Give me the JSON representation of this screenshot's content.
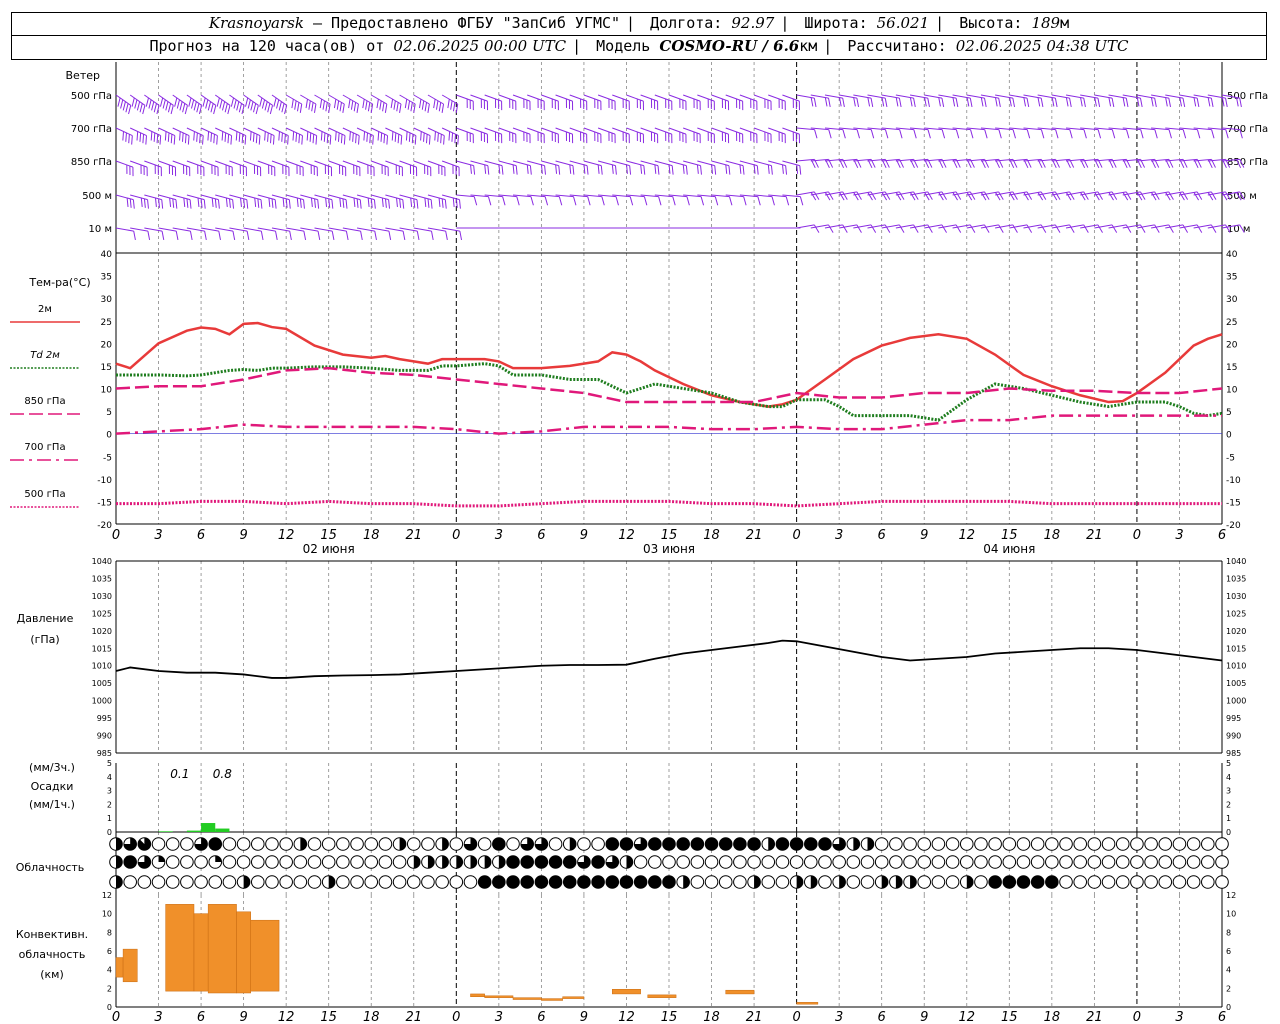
{
  "header": {
    "city": "Krasnoyarsk",
    "provider": "— Предоставлено ФГБУ \"ЗапСиб УГМС\"",
    "lon_label": "Долгота:",
    "lon_value": "92.97",
    "lat_label": "Широта:",
    "lat_value": "56.021",
    "alt_label": "Высота:",
    "alt_value": "189",
    "alt_unit": "м",
    "forecast_label": "Прогноз на 120 часа(ов) от",
    "forecast_from": "02.06.2025 00:00 UTC",
    "model_label": "Модель",
    "model_name": "COSMO-RU / 6.6",
    "model_unit": "км",
    "calc_label": "Рассчитано:",
    "calc_time": "02.06.2025 04:38 UTC"
  },
  "labels": {
    "wind_title": "Ветер",
    "wind_levels": [
      "500 гПа",
      "700 гПа",
      "850 гПа",
      "500 м",
      "10 м"
    ],
    "temp_title": "Тем-ра(°C)",
    "pressure_title": "Давление",
    "pressure_unit": "(гПа)",
    "precip_unit_3h": "(мм/3ч.)",
    "precip_title": "Осадки",
    "precip_unit_1h": "(мм/1ч.)",
    "cloud_title": "Облачность",
    "conv_title_1": "Конвективн.",
    "conv_title_2": "облачность",
    "conv_unit": "(км)"
  },
  "x_axis": {
    "hour_ticks": [
      "0",
      "3",
      "6",
      "9",
      "12",
      "15",
      "18",
      "21",
      "0",
      "3",
      "6",
      "9",
      "12",
      "15",
      "18",
      "21",
      "0",
      "3",
      "6",
      "9",
      "12",
      "15",
      "18",
      "21",
      "0",
      "3",
      "6"
    ],
    "day_labels": [
      "02 июня",
      "03 июня",
      "04 июня"
    ],
    "day_label_hours": [
      15,
      39,
      63
    ],
    "day_boundaries_h": [
      24,
      48,
      72
    ]
  },
  "colors": {
    "wind": "#8a2be2",
    "t2m": "#e83a3a",
    "td2m": "#1e7d1e",
    "t850": "#e0187a",
    "t700": "#e0187a",
    "t500": "#e0187a",
    "pressure": "#000000",
    "precip": "#22cc22",
    "convective": "#f0902a",
    "grid": "#888888"
  },
  "chart_data": [
    {
      "type": "line",
      "title": "Тем-ра(°C)",
      "ylim": [
        -20,
        40
      ],
      "yticks": [
        -20,
        -15,
        -10,
        -5,
        0,
        5,
        10,
        15,
        20,
        25,
        30,
        35,
        40
      ],
      "series": [
        {
          "name": "2м",
          "style": "solid",
          "x": [
            0,
            1,
            3,
            5,
            6,
            7,
            8,
            9,
            10,
            11,
            12,
            14,
            16,
            18,
            19,
            20,
            21,
            22,
            23,
            24,
            26,
            27,
            28,
            30,
            32,
            34,
            35,
            36,
            37,
            38,
            40,
            42,
            44,
            46,
            47,
            48,
            50,
            52,
            54,
            56,
            58,
            60,
            62,
            64,
            66,
            68,
            70,
            71,
            72,
            74,
            76,
            77,
            78
          ],
          "y": [
            15.5,
            14.5,
            20,
            22.8,
            23.5,
            23.2,
            22,
            24.3,
            24.5,
            23.6,
            23.2,
            19.5,
            17.5,
            16.8,
            17.2,
            16.5,
            16,
            15.5,
            16.5,
            16.5,
            16.5,
            16,
            14.5,
            14.5,
            15,
            16,
            18,
            17.5,
            16,
            14,
            11,
            8.5,
            7,
            6,
            6.5,
            7.5,
            12,
            16.5,
            19.5,
            21.2,
            22,
            21,
            17.5,
            13,
            10.5,
            8.5,
            7,
            7.2,
            9,
            13.5,
            19.5,
            21,
            22
          ]
        },
        {
          "name": "Td 2м",
          "style": "dotted",
          "x": [
            0,
            3,
            5,
            6,
            7,
            8,
            9,
            10,
            11,
            12,
            14,
            16,
            18,
            20,
            22,
            23,
            24,
            26,
            27,
            28,
            30,
            32,
            34,
            35,
            36,
            37,
            38,
            40,
            42,
            44,
            46,
            47,
            48,
            50,
            51,
            52,
            54,
            56,
            57,
            58,
            60,
            62,
            64,
            66,
            68,
            70,
            71,
            72,
            74,
            75,
            76,
            77,
            78
          ],
          "y": [
            13,
            13,
            12.8,
            13,
            13.5,
            14,
            14.2,
            14,
            14.5,
            14.5,
            14.8,
            14.8,
            14.5,
            14,
            14,
            15,
            15,
            15.5,
            15,
            13,
            13,
            12,
            12,
            10.5,
            9,
            10,
            11,
            10,
            9,
            7,
            6,
            6,
            7.5,
            7.5,
            6,
            4,
            4,
            4,
            3.5,
            3,
            7.5,
            11,
            10,
            8.5,
            7,
            6,
            6.5,
            7,
            7,
            6,
            4.5,
            4,
            4.5
          ]
        },
        {
          "name": "850 гПа",
          "style": "dashed",
          "x": [
            0,
            3,
            6,
            9,
            12,
            15,
            18,
            21,
            24,
            27,
            30,
            33,
            36,
            39,
            42,
            45,
            48,
            51,
            54,
            57,
            60,
            63,
            66,
            69,
            72,
            75,
            78
          ],
          "y": [
            10,
            10.5,
            10.5,
            12,
            14,
            14.5,
            13.5,
            13,
            12,
            11,
            10,
            9,
            7,
            7,
            7,
            7,
            9,
            8,
            8,
            9,
            9,
            10,
            9.5,
            9.5,
            9,
            9,
            10
          ]
        },
        {
          "name": "700 гПа",
          "style": "dashdot",
          "x": [
            0,
            3,
            6,
            9,
            12,
            15,
            18,
            21,
            24,
            27,
            30,
            33,
            36,
            39,
            42,
            45,
            48,
            51,
            54,
            57,
            60,
            63,
            66,
            69,
            72,
            75,
            78
          ],
          "y": [
            0,
            0.5,
            1,
            2,
            1.5,
            1.5,
            1.5,
            1.5,
            1,
            0,
            0.5,
            1.5,
            1.5,
            1.5,
            1,
            1,
            1.5,
            1,
            1,
            2,
            3,
            3,
            4,
            4,
            4,
            4,
            4
          ]
        },
        {
          "name": "500 гПа",
          "style": "dotted",
          "x": [
            0,
            3,
            6,
            9,
            12,
            15,
            18,
            21,
            24,
            27,
            30,
            33,
            36,
            39,
            42,
            45,
            48,
            51,
            54,
            57,
            60,
            63,
            66,
            69,
            72,
            75,
            78
          ],
          "y": [
            -15.5,
            -15.5,
            -15,
            -15,
            -15.5,
            -15,
            -15.5,
            -15.5,
            -16,
            -16,
            -15.5,
            -15,
            -15,
            -15,
            -15.5,
            -15.5,
            -16,
            -15.5,
            -15,
            -15,
            -15,
            -15,
            -15.5,
            -15.5,
            -15.5,
            -15.5,
            -15.5
          ]
        }
      ]
    },
    {
      "type": "line",
      "title": "Давление",
      "ylabel": "(гПа)",
      "ylim": [
        985,
        1040
      ],
      "yticks": [
        985,
        990,
        995,
        1000,
        1005,
        1010,
        1015,
        1020,
        1025,
        1030,
        1035,
        1040
      ],
      "series": [
        {
          "x": [
            0,
            1,
            3,
            5,
            7,
            9,
            11,
            12,
            14,
            16,
            18,
            20,
            22,
            24,
            26,
            28,
            30,
            32,
            34,
            36,
            38,
            40,
            42,
            44,
            46,
            47,
            48,
            50,
            52,
            54,
            56,
            58,
            60,
            62,
            64,
            66,
            68,
            70,
            72,
            74,
            76,
            78
          ],
          "y": [
            1008.5,
            1009.5,
            1008.5,
            1008,
            1008,
            1007.5,
            1006.5,
            1006.5,
            1007,
            1007.2,
            1007.3,
            1007.5,
            1008,
            1008.5,
            1009,
            1009.5,
            1010,
            1010.2,
            1010.2,
            1010.3,
            1012,
            1013.5,
            1014.5,
            1015.5,
            1016.5,
            1017.2,
            1017,
            1015.5,
            1014,
            1012.5,
            1011.5,
            1012,
            1012.5,
            1013.5,
            1014,
            1014.5,
            1015,
            1015,
            1014.5,
            1013.5,
            1012.5,
            1011.5
          ]
        }
      ]
    },
    {
      "type": "bar",
      "title": "Осадки",
      "ylim": [
        0,
        5
      ],
      "yticks": [
        0,
        1,
        2,
        3,
        4,
        5
      ],
      "labels_3h": [
        {
          "x_h": 4.5,
          "text": "0.1"
        },
        {
          "x_h": 7.5,
          "text": "0.8"
        }
      ],
      "bars": [
        {
          "x0": 3,
          "x1": 4,
          "value": 0.05
        },
        {
          "x0": 5,
          "x1": 6,
          "value": 0.1
        },
        {
          "x0": 6,
          "x1": 7,
          "value": 0.65
        },
        {
          "x0": 7,
          "x1": 8,
          "value": 0.25
        }
      ]
    },
    {
      "type": "table",
      "title": "Облачность",
      "note": "cloud cover symbols per hour, 3 rows, value = oktas 0-8",
      "rows": [
        [
          4,
          6,
          7,
          0,
          0,
          0,
          6,
          8,
          0,
          0,
          0,
          0,
          0,
          4,
          0,
          0,
          0,
          0,
          0,
          0,
          4,
          0,
          0,
          4,
          0,
          6,
          0,
          8,
          0,
          6,
          6,
          0,
          4,
          0,
          0,
          8,
          8,
          6,
          8,
          8,
          8,
          8,
          8,
          8,
          8,
          8,
          4,
          8,
          8,
          8,
          8,
          6,
          4,
          4,
          0,
          0,
          0,
          0,
          0,
          0,
          0,
          0,
          0,
          0,
          0,
          0,
          0,
          0,
          0,
          0,
          0,
          0,
          0,
          0,
          0,
          0,
          0,
          0,
          0
        ],
        [
          4,
          8,
          6,
          2,
          0,
          0,
          0,
          2,
          0,
          0,
          0,
          0,
          0,
          0,
          0,
          0,
          0,
          0,
          0,
          0,
          0,
          4,
          4,
          4,
          4,
          4,
          4,
          4,
          8,
          8,
          8,
          8,
          8,
          6,
          8,
          6,
          4,
          0,
          0,
          0,
          0,
          0,
          0,
          0,
          0,
          0,
          0,
          0,
          0,
          0,
          0,
          0,
          0,
          0,
          0,
          0,
          0,
          0,
          0,
          0,
          0,
          0,
          0,
          0,
          0,
          0,
          0,
          0,
          0,
          0,
          0,
          0,
          0,
          0,
          0,
          0,
          0,
          0,
          0
        ],
        [
          4,
          0,
          0,
          0,
          0,
          0,
          0,
          0,
          0,
          4,
          0,
          0,
          0,
          0,
          0,
          4,
          0,
          0,
          0,
          0,
          0,
          0,
          0,
          0,
          0,
          0,
          8,
          8,
          8,
          8,
          8,
          8,
          8,
          8,
          8,
          8,
          8,
          8,
          8,
          8,
          4,
          0,
          0,
          0,
          0,
          4,
          0,
          0,
          4,
          4,
          0,
          4,
          0,
          0,
          4,
          4,
          4,
          0,
          0,
          0,
          4,
          0,
          8,
          8,
          8,
          8,
          8,
          0,
          0,
          0,
          0,
          0,
          0,
          0,
          0,
          0,
          0,
          0,
          0
        ]
      ]
    },
    {
      "type": "bar",
      "title": "Конвективн. облачность",
      "ylabel": "(км)",
      "ylim": [
        0,
        12
      ],
      "yticks": [
        0,
        2,
        4,
        6,
        8,
        10,
        12
      ],
      "bars": [
        {
          "x0": 0,
          "x1": 0.5,
          "bottom": 3.2,
          "top": 5.3
        },
        {
          "x0": 0.5,
          "x1": 1.5,
          "bottom": 2.7,
          "top": 6.2
        },
        {
          "x0": 3.5,
          "x1": 5.5,
          "bottom": 1.7,
          "top": 11.0
        },
        {
          "x0": 5.5,
          "x1": 6.5,
          "bottom": 1.7,
          "top": 10.0
        },
        {
          "x0": 6.5,
          "x1": 8.5,
          "bottom": 1.5,
          "top": 11.0
        },
        {
          "x0": 8.5,
          "x1": 9.5,
          "bottom": 1.5,
          "top": 10.2
        },
        {
          "x0": 9.5,
          "x1": 11.5,
          "bottom": 1.7,
          "top": 9.3
        },
        {
          "x0": 25,
          "x1": 26,
          "bottom": 1.1,
          "top": 1.4
        },
        {
          "x0": 26,
          "x1": 28,
          "bottom": 1.0,
          "top": 1.2
        },
        {
          "x0": 28,
          "x1": 30,
          "bottom": 0.8,
          "top": 1.0
        },
        {
          "x0": 30,
          "x1": 31.5,
          "bottom": 0.7,
          "top": 0.9
        },
        {
          "x0": 31.5,
          "x1": 33,
          "bottom": 0.9,
          "top": 1.1
        },
        {
          "x0": 35,
          "x1": 37,
          "bottom": 1.4,
          "top": 1.9
        },
        {
          "x0": 37.5,
          "x1": 39.5,
          "bottom": 1.0,
          "top": 1.3
        },
        {
          "x0": 43,
          "x1": 45,
          "bottom": 1.4,
          "top": 1.8
        },
        {
          "x0": 48,
          "x1": 49.5,
          "bottom": 0.3,
          "top": 0.5
        }
      ]
    }
  ],
  "wind": {
    "levels": [
      "500 гПа",
      "700 гПа",
      "850 гПа",
      "500 м",
      "10 м"
    ],
    "hours_step": 1,
    "note": "barbs: direction in degrees and speed in m/s per level segment",
    "segments": [
      {
        "level": 0,
        "from_h": 0,
        "to_h": 12,
        "dir": 235,
        "speed": 22
      },
      {
        "level": 0,
        "from_h": 12,
        "to_h": 24,
        "dir": 240,
        "speed": 18
      },
      {
        "level": 0,
        "from_h": 24,
        "to_h": 48,
        "dir": 250,
        "speed": 14
      },
      {
        "level": 0,
        "from_h": 48,
        "to_h": 78,
        "dir": 260,
        "speed": 10
      },
      {
        "level": 1,
        "from_h": 0,
        "to_h": 24,
        "dir": 245,
        "speed": 16
      },
      {
        "level": 1,
        "from_h": 24,
        "to_h": 48,
        "dir": 250,
        "speed": 12
      },
      {
        "level": 1,
        "from_h": 48,
        "to_h": 78,
        "dir": 265,
        "speed": 6
      },
      {
        "level": 2,
        "from_h": 0,
        "to_h": 24,
        "dir": 250,
        "speed": 14
      },
      {
        "level": 2,
        "from_h": 24,
        "to_h": 48,
        "dir": 255,
        "speed": 8
      },
      {
        "level": 2,
        "from_h": 48,
        "to_h": 78,
        "dir": 275,
        "speed": 9
      },
      {
        "level": 3,
        "from_h": 0,
        "to_h": 24,
        "dir": 255,
        "speed": 12
      },
      {
        "level": 3,
        "from_h": 24,
        "to_h": 48,
        "dir": 265,
        "speed": 7
      },
      {
        "level": 3,
        "from_h": 48,
        "to_h": 78,
        "dir": 280,
        "speed": 8
      },
      {
        "level": 4,
        "from_h": 0,
        "to_h": 24,
        "dir": 260,
        "speed": 6
      },
      {
        "level": 4,
        "from_h": 24,
        "to_h": 48,
        "dir": 270,
        "speed": 3
      },
      {
        "level": 4,
        "from_h": 48,
        "to_h": 78,
        "dir": 280,
        "speed": 5
      }
    ]
  }
}
